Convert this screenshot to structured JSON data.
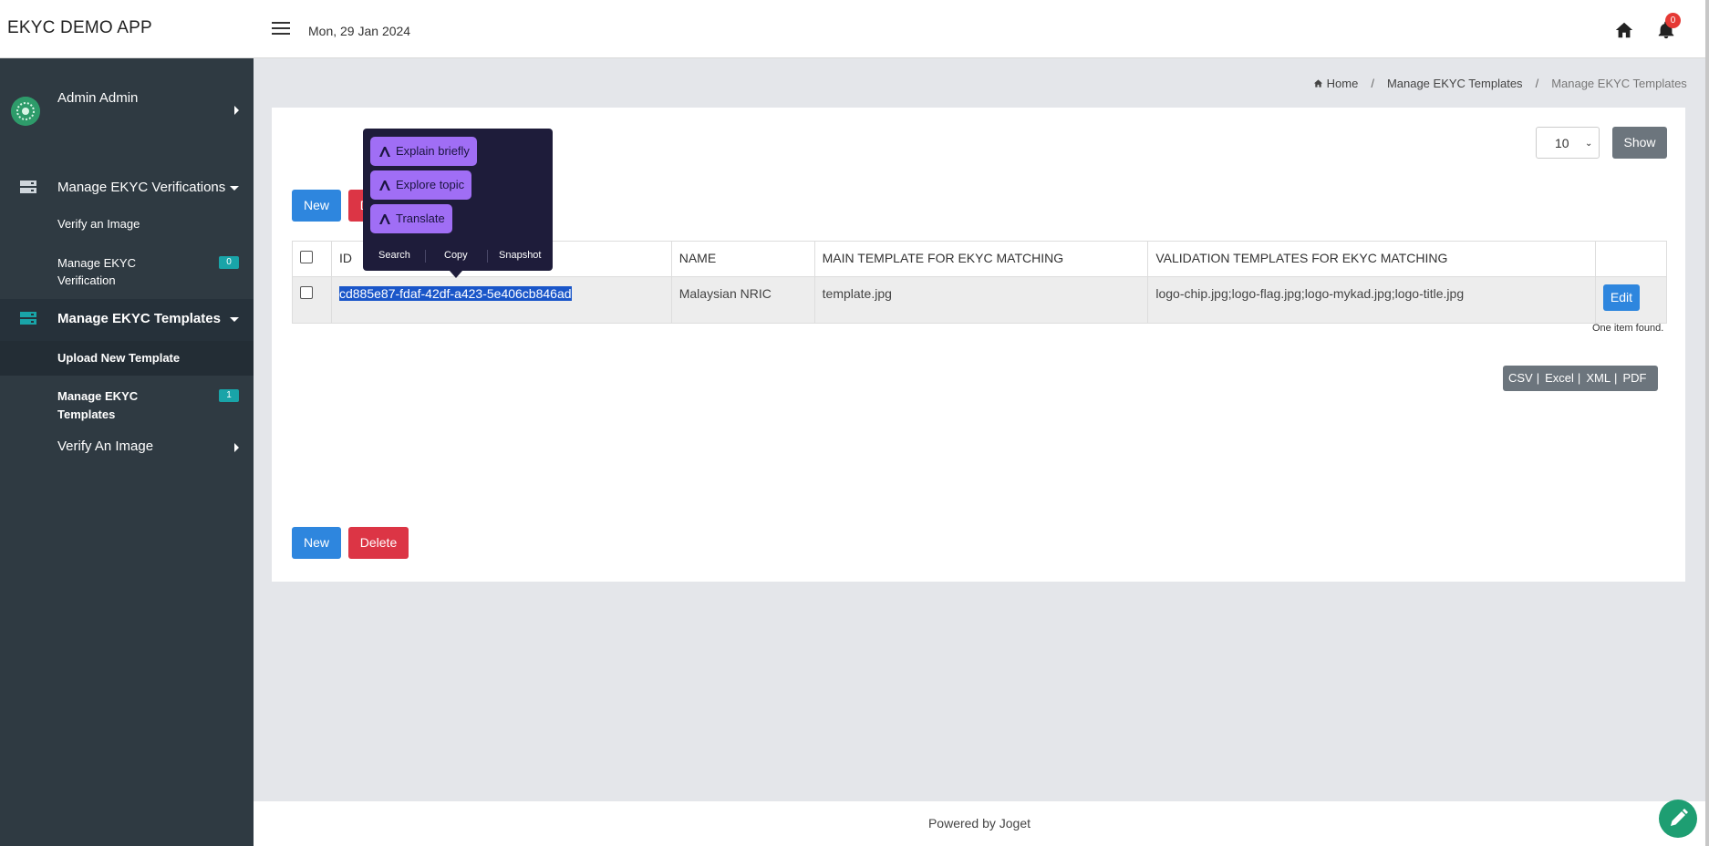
{
  "app": {
    "title": "EKYC DEMO APP",
    "date": "Mon, 29 Jan 2024",
    "notification_count": "0"
  },
  "sidebar": {
    "user": "Admin Admin",
    "sections": [
      {
        "title": "Manage EKYC Verifications",
        "items": [
          {
            "label": "Verify an Image"
          },
          {
            "label": "Manage EKYC Verification",
            "badge": "0"
          }
        ]
      },
      {
        "title": "Manage EKYC Templates",
        "items": [
          {
            "label": "Upload New Template"
          },
          {
            "label": "Manage EKYC Templates",
            "badge": "1"
          }
        ]
      },
      {
        "title": "Verify An Image"
      }
    ]
  },
  "breadcrumb": {
    "home": "Home",
    "parent": "Manage EKYC Templates",
    "current": "Manage EKYC Templates",
    "separator": "/"
  },
  "toolbar": {
    "page_size": "10",
    "show_label": "Show",
    "new_label": "New",
    "delete_label": "Delete"
  },
  "table": {
    "headers": [
      "ID",
      "NAME",
      "MAIN TEMPLATE FOR EKYC MATCHING",
      "VALIDATION TEMPLATES FOR EKYC MATCHING"
    ],
    "rows": [
      {
        "id": "cd885e87-fdaf-42df-a423-5e406cb846ad",
        "name": "Malaysian NRIC",
        "main_template": "template.jpg",
        "validation_templates": "logo-chip.jpg;logo-flag.jpg;logo-mykad.jpg;logo-title.jpg",
        "action": "Edit"
      }
    ],
    "footer_text": "One item found."
  },
  "export": {
    "csv": "CSV",
    "excel": "Excel",
    "xml": "XML",
    "pdf": "PDF",
    "separator": "|"
  },
  "popup": {
    "pills": [
      "Explain briefly",
      "Explore topic",
      "Translate"
    ],
    "actions": [
      "Search",
      "Copy",
      "Snapshot"
    ]
  },
  "footer": {
    "text": "Powered by Joget"
  },
  "colors": {
    "sidebar_bg": "#2f3a42",
    "primary": "#2e86de",
    "danger": "#dc3545",
    "teal_badge": "#19a4a8",
    "popup_bg": "#1e1c3a",
    "popup_pill": "#a06ef5"
  }
}
